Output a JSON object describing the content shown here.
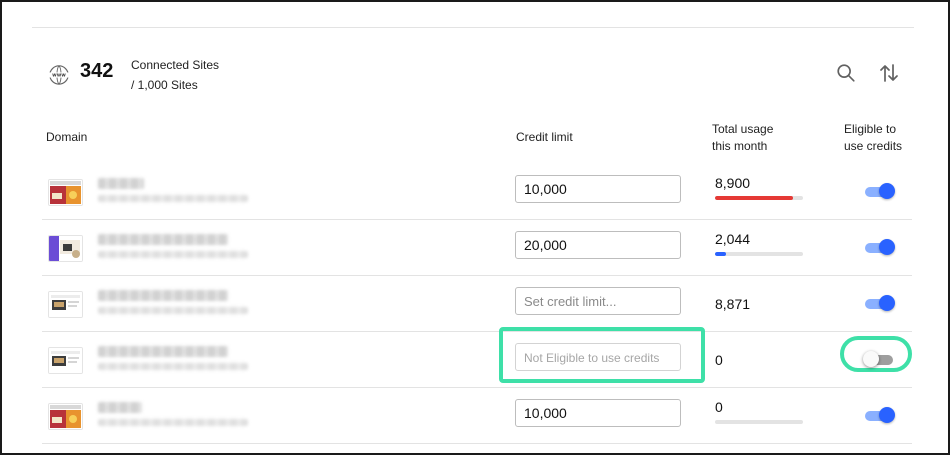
{
  "summary": {
    "connected_count": "342",
    "connected_label": "Connected Sites",
    "total_label": "/ 1,000 Sites",
    "icons": {
      "sites": "globe-www-icon",
      "search": "search-icon",
      "sort": "sort-arrows-icon"
    }
  },
  "columns": {
    "domain": "Domain",
    "credit_limit": "Credit limit",
    "usage_line1": "Total usage",
    "usage_line2": "this month",
    "eligible_line1": "Eligible to",
    "eligible_line2": "use credits"
  },
  "colors": {
    "accent": "#2962ff",
    "over_limit": "#e53935",
    "highlight": "#3ee0a8"
  },
  "rows": [
    {
      "credit_value": "10,000",
      "credit_placeholder": "",
      "usage": "8,900",
      "usage_fraction": 0.89,
      "usage_color": "#e53935",
      "eligible": true
    },
    {
      "credit_value": "20,000",
      "credit_placeholder": "",
      "usage": "2,044",
      "usage_fraction": 0.12,
      "usage_color": "#2962ff",
      "eligible": true
    },
    {
      "credit_value": "",
      "credit_placeholder": "Set credit limit...",
      "usage": "8,871",
      "usage_fraction": null,
      "usage_color": "",
      "eligible": true
    },
    {
      "credit_value": "",
      "credit_placeholder": "Not Eligible to use credits",
      "usage": "0",
      "usage_fraction": null,
      "usage_color": "",
      "eligible": false
    },
    {
      "credit_value": "10,000",
      "credit_placeholder": "",
      "usage": "0",
      "usage_fraction": 0,
      "usage_color": "#2962ff",
      "eligible": true
    }
  ]
}
